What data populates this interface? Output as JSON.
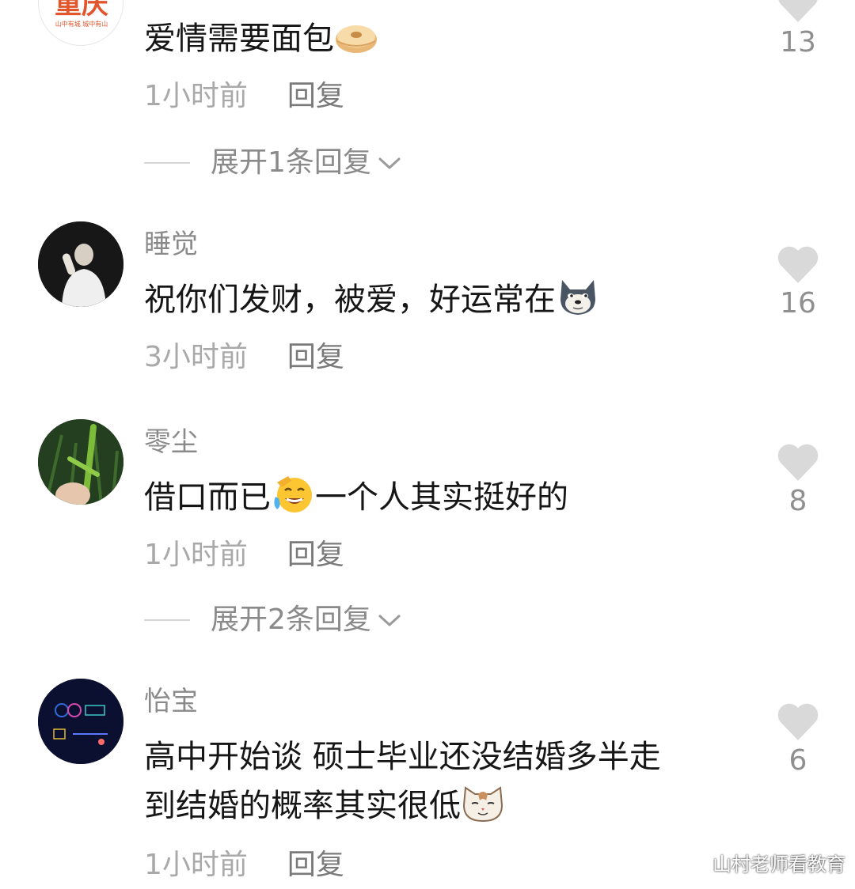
{
  "comments": [
    {
      "username": "",
      "content": "爱情需要面包",
      "emoji": "bagel-emoji",
      "time": "1小时前",
      "reply_label": "回复",
      "likes": "13",
      "expand": "展开1条回复",
      "avatar_text": "重庆",
      "avatar_subtext": "山中有城 城中有山"
    },
    {
      "username": "睡觉",
      "content": "祝你们发财，被爱，好运常在",
      "emoji": "husky-emoji",
      "time": "3小时前",
      "reply_label": "回复",
      "likes": "16"
    },
    {
      "username": "零尘",
      "content_before": "借口而已",
      "content_after": "一个人其实挺好的",
      "emoji": "laugh-cry-emoji",
      "time": "1小时前",
      "reply_label": "回复",
      "likes": "8",
      "expand": "展开2条回复"
    },
    {
      "username": "怡宝",
      "content_line1": "高中开始谈 硕士毕业还没结婚多半走",
      "content_line2": "到结婚的概率其实很低",
      "emoji": "cat-emoji",
      "time": "1小时前",
      "reply_label": "回复",
      "likes": "6"
    }
  ],
  "watermark": "山村老师看教育",
  "colors": {
    "text": "#161616",
    "secondary": "#8a8a8a",
    "heart": "#d9d9d9"
  }
}
